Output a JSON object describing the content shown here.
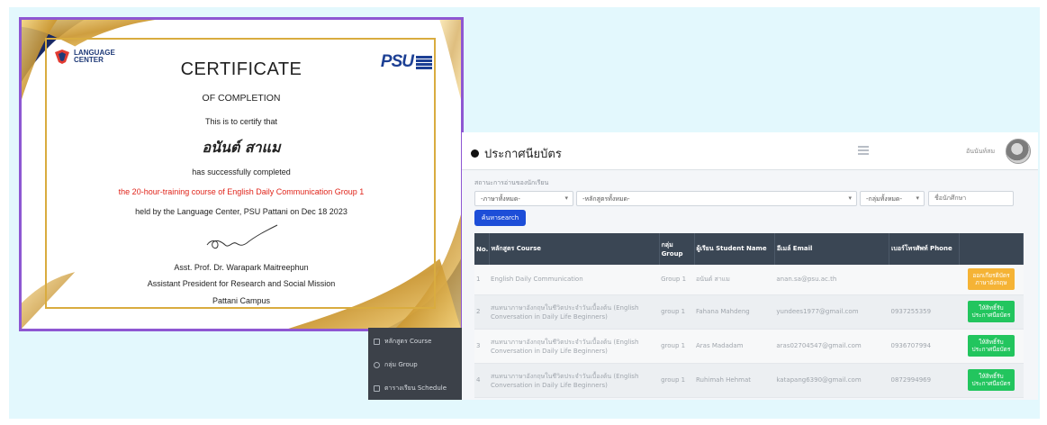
{
  "certificate": {
    "org_name": "LANGUAGE\nCENTER",
    "psu_logo": "PSU",
    "title": "CERTIFICATE",
    "subtitle": "OF COMPLETION",
    "certify_line": "This is to certify that",
    "recipient": "อนันต์ สาแม",
    "completed_line": "has successfully completed",
    "course_line": "the 20-hour-training course of English Daily Communication Group 1",
    "held_line": "held by the Language Center, PSU Pattani on Dec 18 2023",
    "signer_name": "Asst. Prof. Dr. Warapark Maitreephun",
    "signer_title": "Assistant President for Research and Social Mission",
    "campus": "Pattani Campus",
    "colors": {
      "border": "#8e57d2",
      "gold": "#d9ac3f",
      "navy": "#1c3f94",
      "course_text": "#e0241a"
    }
  },
  "app": {
    "title": "ประกาศนียบัตร",
    "user_name": "อันนันท์สม",
    "filter_label": "สถานะการอ่านของนักเรียน",
    "filters": {
      "language": "-ภาษาทั้งหมด-",
      "course": "-หลักสูตรทั้งหมด-",
      "group": "-กลุ่มทั้งหมด-",
      "student_placeholder": "ชื่อนักศึกษา"
    },
    "search_button": "ค้นหาsearch",
    "table": {
      "headers": {
        "no": "No.",
        "course": "หลักสูตร Course",
        "group": "กลุ่ม Group",
        "student": "ผู้เรียน Student Name",
        "email": "อีเมล์ Email",
        "phone": "เบอร์โทรศัพท์ Phone",
        "action": ""
      },
      "rows": [
        {
          "no": "1",
          "course": "English Daily Communication",
          "group": "Group 1",
          "student": "อนันต์ สาแม",
          "email": "anan.sa@psu.ac.th",
          "phone": "",
          "action": "ออกเกียรติบัตรภาษาอังกฤษ"
        },
        {
          "no": "2",
          "course": "สนทนาภาษาอังกฤษในชีวิตประจำวันเบื้องต้น (English Conversation in Daily Life Beginners)",
          "group": "group 1",
          "student": "Fahana Mahdeng",
          "email": "yundees1977@gmail.com",
          "phone": "0937255359",
          "action": "ให้สิทธิ์รับประกาศนียบัตร"
        },
        {
          "no": "3",
          "course": "สนทนาภาษาอังกฤษในชีวิตประจำวันเบื้องต้น (English Conversation in Daily Life Beginners)",
          "group": "group 1",
          "student": "Aras Madadam",
          "email": "aras02704547@gmail.com",
          "phone": "0936707994",
          "action": "ให้สิทธิ์รับประกาศนียบัตร"
        },
        {
          "no": "4",
          "course": "สนทนาภาษาอังกฤษในชีวิตประจำวันเบื้องต้น (English Conversation in Daily Life Beginners)",
          "group": "group 1",
          "student": "Ruhimah Hehmat",
          "email": "katapang6390@gmail.com",
          "phone": "0872994969",
          "action": "ให้สิทธิ์รับประกาศนียบัตร"
        }
      ]
    },
    "colors": {
      "header": "#3a4654",
      "search": "#1d4ed8",
      "warn": "#f5b335",
      "ok": "#22c55e"
    }
  },
  "sidebar": {
    "items": [
      {
        "label": "หลักสูตร Course",
        "icon": "list-icon"
      },
      {
        "label": "กลุ่ม Group",
        "icon": "group-icon"
      },
      {
        "label": "ตารางเรียน Schedule",
        "icon": "calendar-icon"
      }
    ]
  }
}
